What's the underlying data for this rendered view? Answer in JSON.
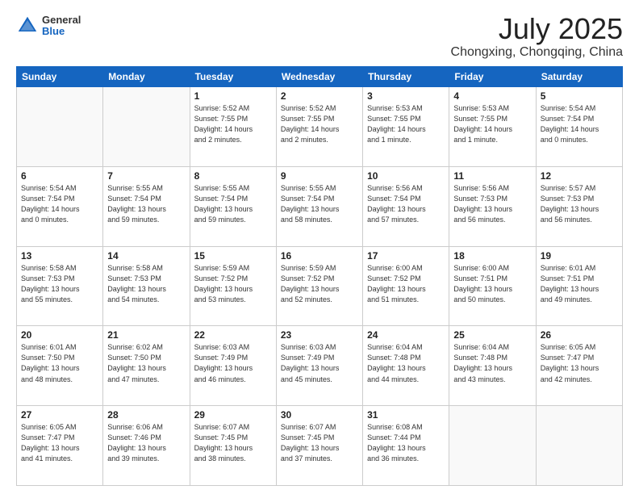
{
  "header": {
    "logo": {
      "general": "General",
      "blue": "Blue"
    },
    "title": "July 2025",
    "location": "Chongxing, Chongqing, China"
  },
  "weekdays": [
    "Sunday",
    "Monday",
    "Tuesday",
    "Wednesday",
    "Thursday",
    "Friday",
    "Saturday"
  ],
  "weeks": [
    [
      {
        "day": "",
        "info": ""
      },
      {
        "day": "",
        "info": ""
      },
      {
        "day": "1",
        "info": "Sunrise: 5:52 AM\nSunset: 7:55 PM\nDaylight: 14 hours\nand 2 minutes."
      },
      {
        "day": "2",
        "info": "Sunrise: 5:52 AM\nSunset: 7:55 PM\nDaylight: 14 hours\nand 2 minutes."
      },
      {
        "day": "3",
        "info": "Sunrise: 5:53 AM\nSunset: 7:55 PM\nDaylight: 14 hours\nand 1 minute."
      },
      {
        "day": "4",
        "info": "Sunrise: 5:53 AM\nSunset: 7:55 PM\nDaylight: 14 hours\nand 1 minute."
      },
      {
        "day": "5",
        "info": "Sunrise: 5:54 AM\nSunset: 7:54 PM\nDaylight: 14 hours\nand 0 minutes."
      }
    ],
    [
      {
        "day": "6",
        "info": "Sunrise: 5:54 AM\nSunset: 7:54 PM\nDaylight: 14 hours\nand 0 minutes."
      },
      {
        "day": "7",
        "info": "Sunrise: 5:55 AM\nSunset: 7:54 PM\nDaylight: 13 hours\nand 59 minutes."
      },
      {
        "day": "8",
        "info": "Sunrise: 5:55 AM\nSunset: 7:54 PM\nDaylight: 13 hours\nand 59 minutes."
      },
      {
        "day": "9",
        "info": "Sunrise: 5:55 AM\nSunset: 7:54 PM\nDaylight: 13 hours\nand 58 minutes."
      },
      {
        "day": "10",
        "info": "Sunrise: 5:56 AM\nSunset: 7:54 PM\nDaylight: 13 hours\nand 57 minutes."
      },
      {
        "day": "11",
        "info": "Sunrise: 5:56 AM\nSunset: 7:53 PM\nDaylight: 13 hours\nand 56 minutes."
      },
      {
        "day": "12",
        "info": "Sunrise: 5:57 AM\nSunset: 7:53 PM\nDaylight: 13 hours\nand 56 minutes."
      }
    ],
    [
      {
        "day": "13",
        "info": "Sunrise: 5:58 AM\nSunset: 7:53 PM\nDaylight: 13 hours\nand 55 minutes."
      },
      {
        "day": "14",
        "info": "Sunrise: 5:58 AM\nSunset: 7:53 PM\nDaylight: 13 hours\nand 54 minutes."
      },
      {
        "day": "15",
        "info": "Sunrise: 5:59 AM\nSunset: 7:52 PM\nDaylight: 13 hours\nand 53 minutes."
      },
      {
        "day": "16",
        "info": "Sunrise: 5:59 AM\nSunset: 7:52 PM\nDaylight: 13 hours\nand 52 minutes."
      },
      {
        "day": "17",
        "info": "Sunrise: 6:00 AM\nSunset: 7:52 PM\nDaylight: 13 hours\nand 51 minutes."
      },
      {
        "day": "18",
        "info": "Sunrise: 6:00 AM\nSunset: 7:51 PM\nDaylight: 13 hours\nand 50 minutes."
      },
      {
        "day": "19",
        "info": "Sunrise: 6:01 AM\nSunset: 7:51 PM\nDaylight: 13 hours\nand 49 minutes."
      }
    ],
    [
      {
        "day": "20",
        "info": "Sunrise: 6:01 AM\nSunset: 7:50 PM\nDaylight: 13 hours\nand 48 minutes."
      },
      {
        "day": "21",
        "info": "Sunrise: 6:02 AM\nSunset: 7:50 PM\nDaylight: 13 hours\nand 47 minutes."
      },
      {
        "day": "22",
        "info": "Sunrise: 6:03 AM\nSunset: 7:49 PM\nDaylight: 13 hours\nand 46 minutes."
      },
      {
        "day": "23",
        "info": "Sunrise: 6:03 AM\nSunset: 7:49 PM\nDaylight: 13 hours\nand 45 minutes."
      },
      {
        "day": "24",
        "info": "Sunrise: 6:04 AM\nSunset: 7:48 PM\nDaylight: 13 hours\nand 44 minutes."
      },
      {
        "day": "25",
        "info": "Sunrise: 6:04 AM\nSunset: 7:48 PM\nDaylight: 13 hours\nand 43 minutes."
      },
      {
        "day": "26",
        "info": "Sunrise: 6:05 AM\nSunset: 7:47 PM\nDaylight: 13 hours\nand 42 minutes."
      }
    ],
    [
      {
        "day": "27",
        "info": "Sunrise: 6:05 AM\nSunset: 7:47 PM\nDaylight: 13 hours\nand 41 minutes."
      },
      {
        "day": "28",
        "info": "Sunrise: 6:06 AM\nSunset: 7:46 PM\nDaylight: 13 hours\nand 39 minutes."
      },
      {
        "day": "29",
        "info": "Sunrise: 6:07 AM\nSunset: 7:45 PM\nDaylight: 13 hours\nand 38 minutes."
      },
      {
        "day": "30",
        "info": "Sunrise: 6:07 AM\nSunset: 7:45 PM\nDaylight: 13 hours\nand 37 minutes."
      },
      {
        "day": "31",
        "info": "Sunrise: 6:08 AM\nSunset: 7:44 PM\nDaylight: 13 hours\nand 36 minutes."
      },
      {
        "day": "",
        "info": ""
      },
      {
        "day": "",
        "info": ""
      }
    ]
  ]
}
